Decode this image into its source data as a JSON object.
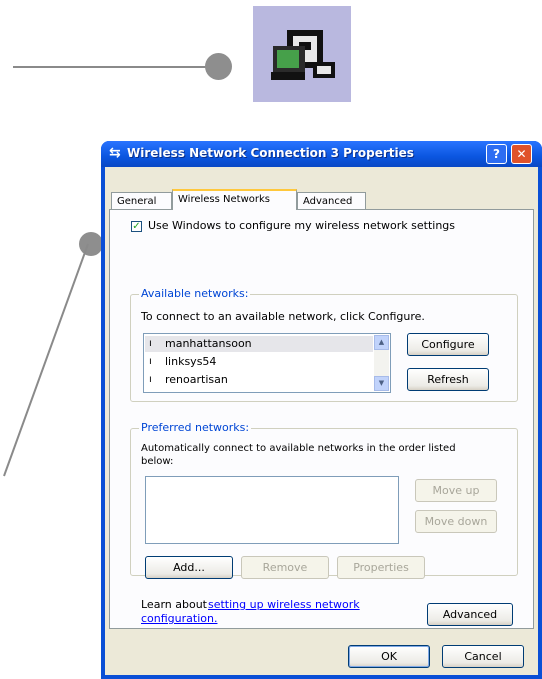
{
  "dialog": {
    "title": "Wireless Network Connection 3 Properties",
    "help_glyph": "?",
    "close_glyph": "✕",
    "tabs": [
      {
        "label": "General"
      },
      {
        "label": "Wireless Networks"
      },
      {
        "label": "Advanced"
      }
    ],
    "use_windows_label": "Use Windows to configure my wireless network settings",
    "use_windows_checked": true,
    "available": {
      "title": "Available networks:",
      "instruction": "To connect to an available network, click Configure.",
      "networks": [
        "manhattansoon",
        "linksys54",
        "renoartisan"
      ],
      "configure_label": "Configure",
      "refresh_label": "Refresh"
    },
    "preferred": {
      "title": "Preferred networks:",
      "instruction_line1": "Automatically connect to available networks in the order listed",
      "instruction_line2": "below:",
      "move_up_label": "Move up",
      "move_down_label": "Move down",
      "add_label": "Add...",
      "remove_label": "Remove",
      "properties_label": "Properties"
    },
    "learn_text": "Learn about ",
    "learn_link_line1": "setting up wireless network",
    "learn_link_line2": "configuration.",
    "advanced_label": "Advanced",
    "ok_label": "OK",
    "cancel_label": "Cancel"
  },
  "colors": {
    "title_bar": "#0b56e0",
    "dialog_face": "#ece9d8",
    "icon_bg": "#b9b8df",
    "callout": "#8a8a8a"
  }
}
